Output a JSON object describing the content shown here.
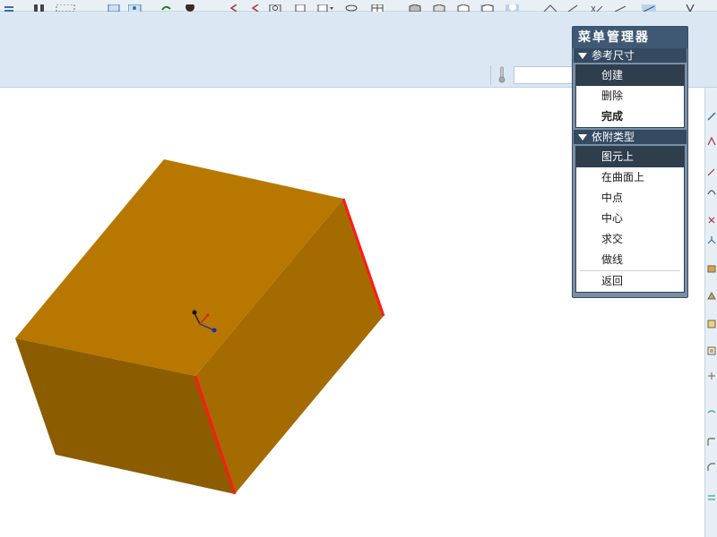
{
  "menu_manager": {
    "title": "菜单管理器",
    "section1": {
      "label": "参考尺寸",
      "items": [
        "创建",
        "删除",
        "完成"
      ],
      "selected_index": 0
    },
    "section2": {
      "label": "依附类型",
      "items": [
        "图元上",
        "在曲面上",
        "中点",
        "中心",
        "求交",
        "做线"
      ],
      "selected_index": 0
    },
    "back_label": "返回"
  },
  "colors": {
    "box_top": "#b87800",
    "box_left": "#8c5c00",
    "box_right": "#a46c00",
    "edge_highlight": "#ff1a1a",
    "menu_title_bg": "#3f5974",
    "ribbon_bg": "#dbe8f3"
  },
  "icons": {
    "toolbar": [
      "menu-icon",
      "pause-icon",
      "box-select-icon",
      "view-icon",
      "info-icon",
      "spin-icon",
      "sphere-icon",
      "arrow-icon",
      "arrow-icon",
      "zoom-box-icon",
      "copy-icon",
      "dropdown-icon",
      "repaint-icon",
      "grid-icon",
      "shade-icon",
      "shade-icon",
      "shade-icon",
      "shade-icon",
      "shade-icon",
      "datum-icon",
      "datum-icon",
      "datum-icon",
      "datum-icon",
      "datum-icon",
      "help-icon"
    ],
    "ribbon": "thermometer-icon",
    "coordinate_system": "coordinate-system-icon"
  }
}
